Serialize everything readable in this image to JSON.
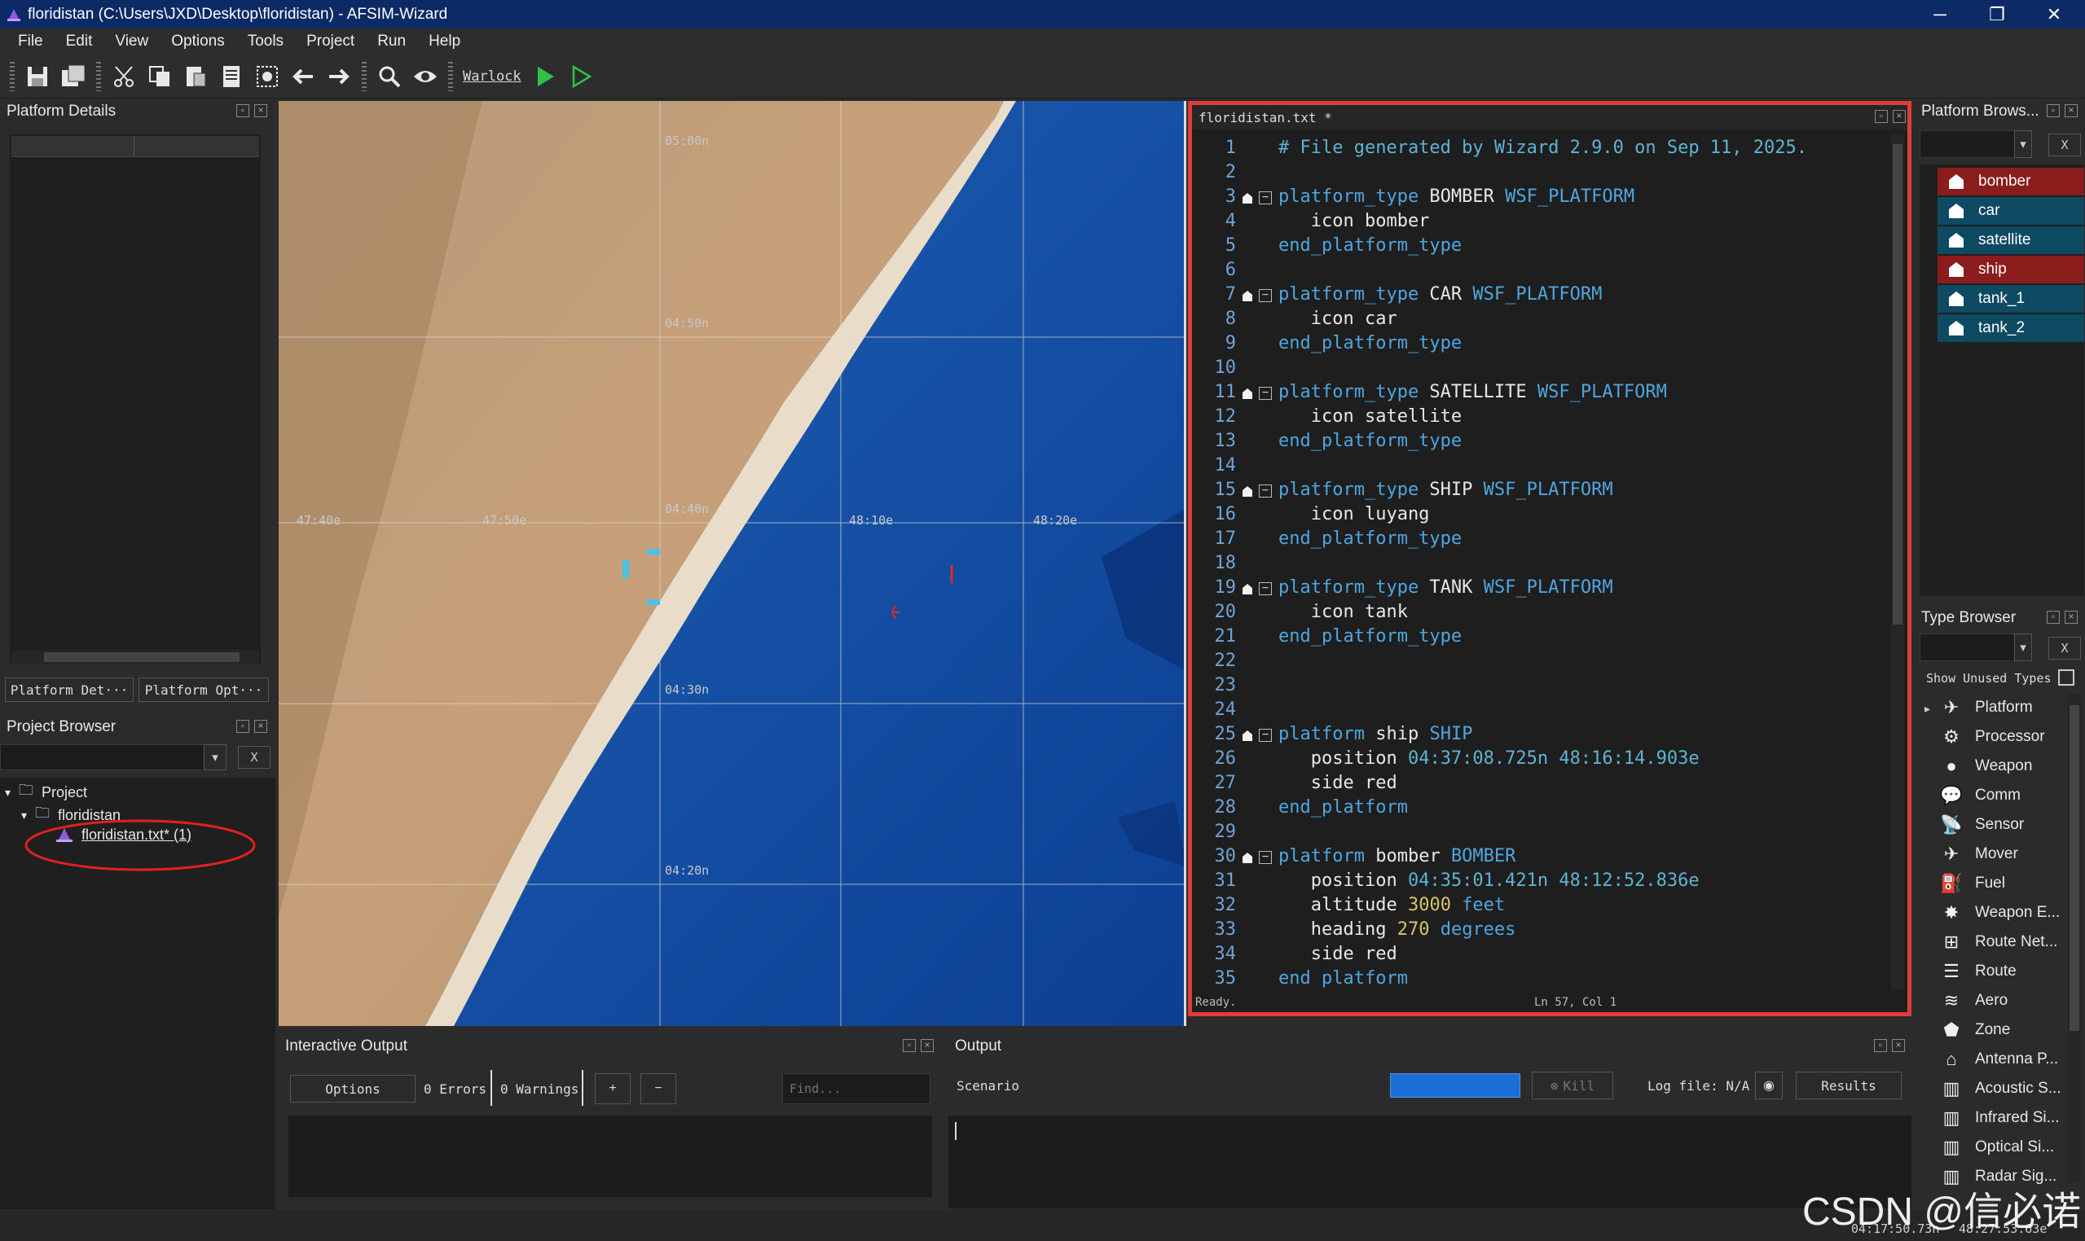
{
  "window": {
    "title": "floridistan (C:\\Users\\JXD\\Desktop\\floridistan) - AFSIM-Wizard",
    "minimize": "─",
    "maximize": "❐",
    "close": "✕"
  },
  "menu": [
    "File",
    "Edit",
    "View",
    "Options",
    "Tools",
    "Project",
    "Run",
    "Help"
  ],
  "toolbar": {
    "icons": [
      "save-icon",
      "save-all-icon",
      "cut-icon",
      "copy-icon",
      "paste-icon",
      "print-icon",
      "screenshot-icon",
      "back-arrow-icon",
      "forward-arrow-icon",
      "search-icon",
      "eye-icon"
    ],
    "warlock_label": "Warlock",
    "run_icon": "play-filled-icon",
    "run_outline_icon": "play-outline-icon"
  },
  "platform_details": {
    "title": "Platform Details",
    "tabs": [
      "Platform Det···",
      "Platform Opt···"
    ]
  },
  "project_browser": {
    "title": "Project Browser",
    "clear_label": "X",
    "tree": {
      "root": "Project",
      "project": "floridistan",
      "file": "floridistan.txt* (1)"
    }
  },
  "map": {
    "lat_labels": [
      "05:00n",
      "04:50n",
      "04:40n",
      "04:30n",
      "04:20n"
    ],
    "lon_labels": [
      "47:40e",
      "47:50e",
      "48:10e",
      "48:20e"
    ]
  },
  "editor": {
    "tab": "floridistan.txt *",
    "status_left": "Ready.",
    "status_right": "Ln 57, Col 1",
    "lines": [
      {
        "n": "1",
        "t": [
          [
            "cm",
            "# File generated by Wizard 2.9.0 on Sep 11, 2025."
          ]
        ]
      },
      {
        "n": "2",
        "t": []
      },
      {
        "n": "3",
        "fold": true,
        "t": [
          [
            "kw",
            "platform_type"
          ],
          [
            "tx",
            " BOMBER "
          ],
          [
            "kw",
            "WSF_PLATFORM"
          ]
        ]
      },
      {
        "n": "4",
        "t": [
          [
            "tx",
            "   icon bomber"
          ]
        ]
      },
      {
        "n": "5",
        "t": [
          [
            "kw",
            "end_platform_type"
          ]
        ]
      },
      {
        "n": "6",
        "t": []
      },
      {
        "n": "7",
        "fold": true,
        "t": [
          [
            "kw",
            "platform_type"
          ],
          [
            "tx",
            " CAR "
          ],
          [
            "kw",
            "WSF_PLATFORM"
          ]
        ]
      },
      {
        "n": "8",
        "t": [
          [
            "tx",
            "   icon car"
          ]
        ]
      },
      {
        "n": "9",
        "t": [
          [
            "kw",
            "end_platform_type"
          ]
        ]
      },
      {
        "n": "10",
        "t": []
      },
      {
        "n": "11",
        "fold": true,
        "t": [
          [
            "kw",
            "platform_type"
          ],
          [
            "tx",
            " SATELLITE "
          ],
          [
            "kw",
            "WSF_PLATFORM"
          ]
        ]
      },
      {
        "n": "12",
        "t": [
          [
            "tx",
            "   icon satellite"
          ]
        ]
      },
      {
        "n": "13",
        "t": [
          [
            "kw",
            "end_platform_type"
          ]
        ]
      },
      {
        "n": "14",
        "t": []
      },
      {
        "n": "15",
        "fold": true,
        "t": [
          [
            "kw",
            "platform_type"
          ],
          [
            "tx",
            " SHIP "
          ],
          [
            "kw",
            "WSF_PLATFORM"
          ]
        ]
      },
      {
        "n": "16",
        "t": [
          [
            "tx",
            "   icon luyang"
          ]
        ]
      },
      {
        "n": "17",
        "t": [
          [
            "kw",
            "end_platform_type"
          ]
        ]
      },
      {
        "n": "18",
        "t": []
      },
      {
        "n": "19",
        "fold": true,
        "t": [
          [
            "kw",
            "platform_type"
          ],
          [
            "tx",
            " TANK "
          ],
          [
            "kw",
            "WSF_PLATFORM"
          ]
        ]
      },
      {
        "n": "20",
        "t": [
          [
            "tx",
            "   icon tank"
          ]
        ]
      },
      {
        "n": "21",
        "t": [
          [
            "kw",
            "end_platform_type"
          ]
        ]
      },
      {
        "n": "22",
        "t": []
      },
      {
        "n": "23",
        "t": []
      },
      {
        "n": "24",
        "t": []
      },
      {
        "n": "25",
        "fold": true,
        "t": [
          [
            "kw",
            "platform"
          ],
          [
            "tx",
            " ship "
          ],
          [
            "kw",
            "SHIP"
          ]
        ]
      },
      {
        "n": "26",
        "t": [
          [
            "tx",
            "   position "
          ],
          [
            "lat",
            "04:37:08.725n 48:16:14.903e"
          ]
        ]
      },
      {
        "n": "27",
        "t": [
          [
            "tx",
            "   side red"
          ]
        ]
      },
      {
        "n": "28",
        "t": [
          [
            "kw",
            "end_platform"
          ]
        ]
      },
      {
        "n": "29",
        "t": []
      },
      {
        "n": "30",
        "fold": true,
        "t": [
          [
            "kw",
            "platform"
          ],
          [
            "tx",
            " bomber "
          ],
          [
            "kw",
            "BOMBER"
          ]
        ]
      },
      {
        "n": "31",
        "t": [
          [
            "tx",
            "   position "
          ],
          [
            "lat",
            "04:35:01.421n 48:12:52.836e"
          ]
        ]
      },
      {
        "n": "32",
        "t": [
          [
            "tx",
            "   altitude "
          ],
          [
            "num",
            "3000"
          ],
          [
            "tx",
            " "
          ],
          [
            "kw",
            "feet"
          ]
        ]
      },
      {
        "n": "33",
        "t": [
          [
            "tx",
            "   heading "
          ],
          [
            "num",
            "270"
          ],
          [
            "tx",
            " "
          ],
          [
            "kw",
            "degrees"
          ]
        ]
      },
      {
        "n": "34",
        "t": [
          [
            "tx",
            "   side red"
          ]
        ]
      },
      {
        "n": "35",
        "t": [
          [
            "kw",
            "end platform"
          ]
        ]
      }
    ]
  },
  "platform_browser": {
    "title": "Platform Brows...",
    "clear_label": "X",
    "items": [
      {
        "name": "bomber",
        "color": "#8b1c1c"
      },
      {
        "name": "car",
        "color": "#0f4a63"
      },
      {
        "name": "satellite",
        "color": "#0f4a63"
      },
      {
        "name": "ship",
        "color": "#8b1c1c"
      },
      {
        "name": "tank_1",
        "color": "#0f4a63"
      },
      {
        "name": "tank_2",
        "color": "#0f4a63"
      }
    ]
  },
  "type_browser": {
    "title": "Type Browser",
    "clear_label": "X",
    "show_unused": "Show Unused Types",
    "items": [
      {
        "name": "Platform",
        "icon": "airplane-icon",
        "glyph": "✈"
      },
      {
        "name": "Processor",
        "icon": "gears-icon",
        "glyph": "⚙"
      },
      {
        "name": "Weapon",
        "icon": "bomb-icon",
        "glyph": "●"
      },
      {
        "name": "Comm",
        "icon": "speech-bubble-icon",
        "glyph": "💬"
      },
      {
        "name": "Sensor",
        "icon": "satellite-dish-icon",
        "glyph": "📡"
      },
      {
        "name": "Mover",
        "icon": "jet-icon",
        "glyph": "✈"
      },
      {
        "name": "Fuel",
        "icon": "fuel-pump-icon",
        "glyph": "⛽"
      },
      {
        "name": "Weapon E...",
        "icon": "explosion-icon",
        "glyph": "✸"
      },
      {
        "name": "Route Net...",
        "icon": "network-icon",
        "glyph": "⊞"
      },
      {
        "name": "Route",
        "icon": "route-icon",
        "glyph": "☰"
      },
      {
        "name": "Aero",
        "icon": "wind-icon",
        "glyph": "≋"
      },
      {
        "name": "Zone",
        "icon": "pentagon-icon",
        "glyph": "⬟"
      },
      {
        "name": "Antenna P...",
        "icon": "antenna-icon",
        "glyph": "⌂"
      },
      {
        "name": "Acoustic S...",
        "icon": "bar-chart-icon",
        "glyph": "▥"
      },
      {
        "name": "Infrared Si...",
        "icon": "bar-chart-icon",
        "glyph": "▥"
      },
      {
        "name": "Optical Si...",
        "icon": "bar-chart-icon",
        "glyph": "▥"
      },
      {
        "name": "Radar Sig...",
        "icon": "bar-chart-icon",
        "glyph": "▥"
      }
    ]
  },
  "interactive_output": {
    "title": "Interactive Output",
    "options_label": "Options",
    "errors": "0 Errors",
    "warnings": "0 Warnings",
    "plus": "+",
    "minus": "−",
    "find_placeholder": "Find..."
  },
  "output": {
    "title": "Output",
    "scenario": "Scenario",
    "kill_label": "Kill",
    "log_file": "Log file: N/A",
    "results_label": "Results"
  },
  "statusbar": {
    "lat": "04:17:50.73n",
    "lon": "48:27:53.63e"
  },
  "watermark": "CSDN @信必诺"
}
